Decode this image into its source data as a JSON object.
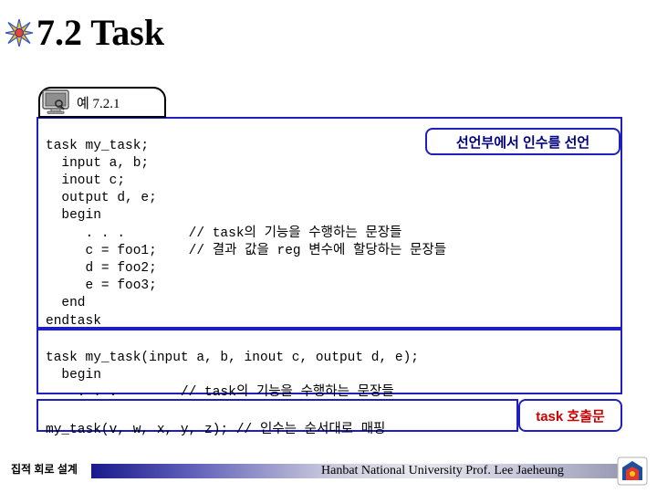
{
  "slide": {
    "title": "7.2 Task",
    "title_icon": "star-burst-icon",
    "example_label": "예 7.2.1",
    "example_icon": "monitor-icon"
  },
  "code_blocks": [
    {
      "id": "task-definition",
      "text": "task my_task;\n  input a, b;\n  inout c;\n  output d, e;\n  begin\n     . . .        // task의 기능을 수행하는 문장들\n     c = foo1;    // 결과 값을 reg 변수에 할당하는 문장들\n     d = foo2;\n     e = foo3;\n  end\nendtask"
    },
    {
      "id": "task-definition-ansi",
      "text": "task my_task(input a, b, inout c, output d, e);\n  begin\n    . . .        // task의 기능을 수행하는 문장들"
    },
    {
      "id": "task-call",
      "text": "my_task(v, w, x, y, z); // 인수는 순서대로 매핑"
    }
  ],
  "callouts": [
    {
      "id": "declaration-note",
      "text": "선언부에서 인수를 선언"
    },
    {
      "id": "task-call-note",
      "text": "task 호출문"
    }
  ],
  "footer": {
    "course": "집적 회로 설계",
    "credit": "Hanbat National University Prof. Lee Jaeheung",
    "logo_icon": "university-logo-icon"
  },
  "colors": {
    "code_border": "#1f1fc0",
    "callout_text": "#000080",
    "callout_red_text": "#cc0000",
    "footer_bar_start": "#1a1a8c"
  }
}
